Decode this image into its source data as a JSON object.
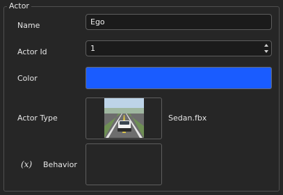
{
  "group": {
    "title": "Actor"
  },
  "fields": {
    "name": {
      "label": "Name",
      "value": "Ego"
    },
    "actor_id": {
      "label": "Actor Id",
      "value": "1"
    },
    "color": {
      "label": "Color",
      "value": "#1a5cff"
    },
    "actor_type": {
      "label": "Actor Type",
      "file": "Sedan.fbx"
    },
    "behavior": {
      "label": "Behavior",
      "icon_text": "(x)",
      "icon": "variable-icon"
    }
  },
  "icons": {
    "spin_up": "chevron-up-icon",
    "spin_down": "chevron-down-icon"
  }
}
